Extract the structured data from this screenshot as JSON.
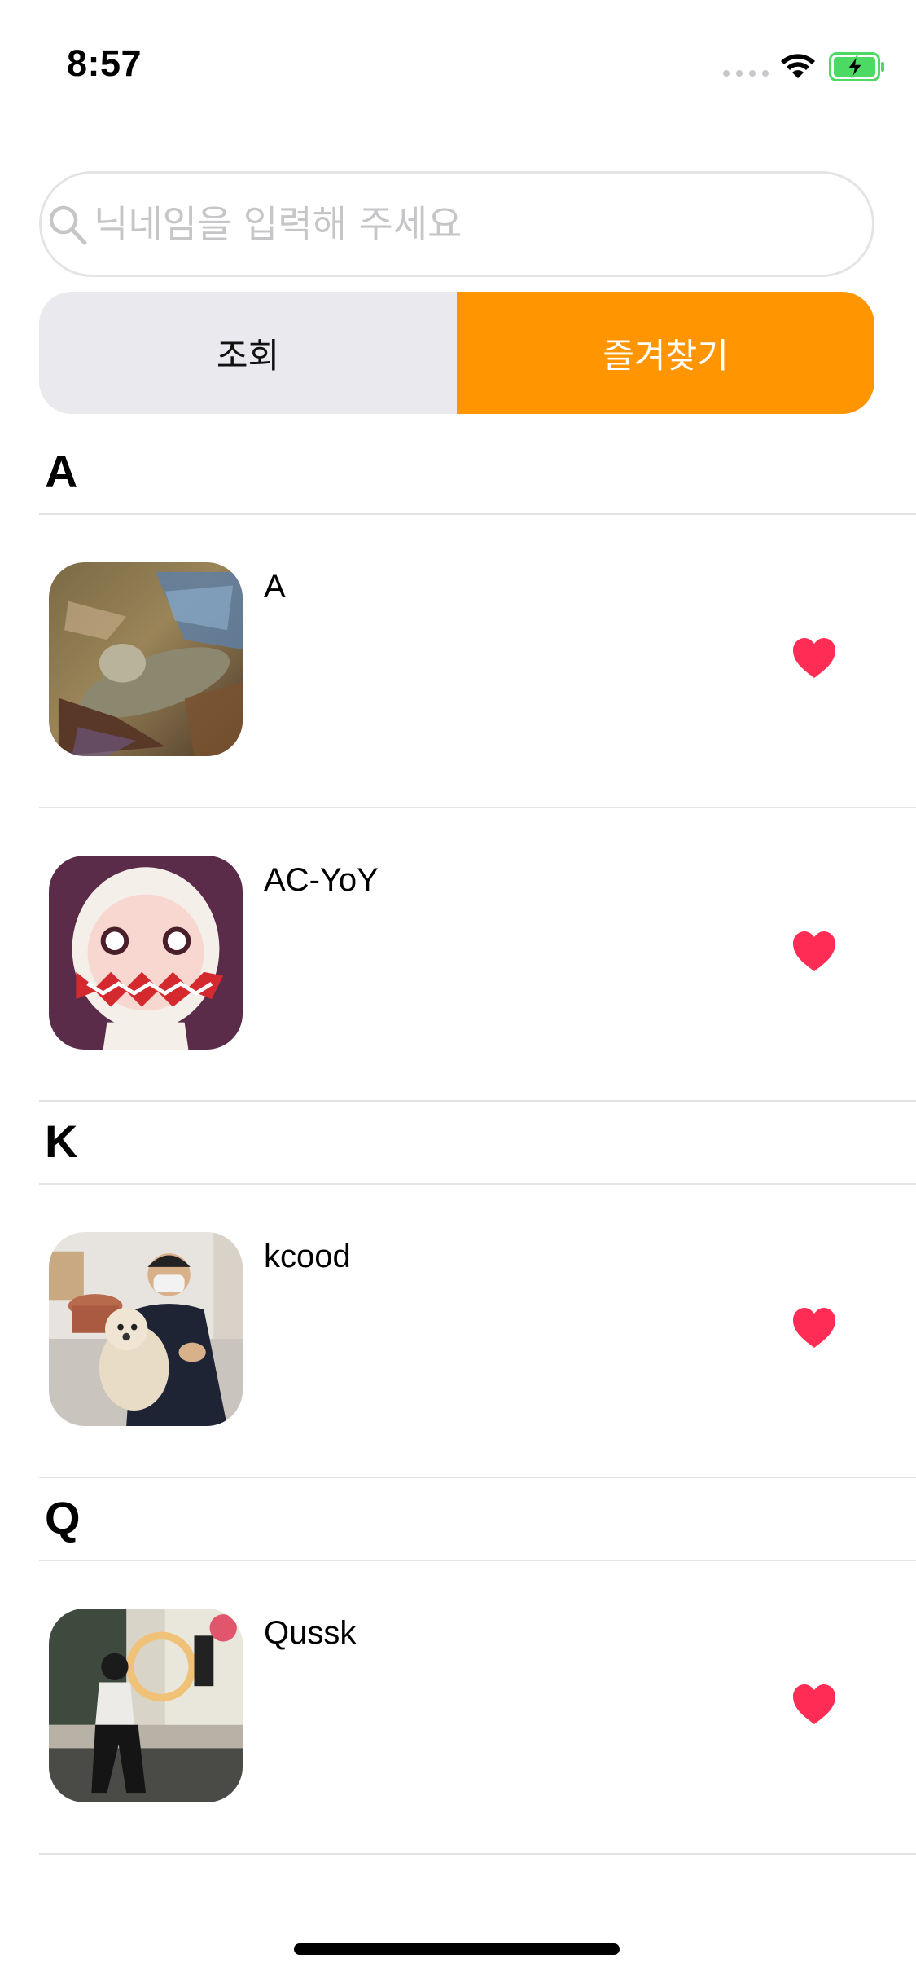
{
  "status_bar": {
    "time": "8:57"
  },
  "search": {
    "placeholder": "닉네임을 입력해 주세요",
    "value": ""
  },
  "segmented": {
    "left_label": "조회",
    "right_label": "즐겨찾기",
    "selected": "즐겨찾기"
  },
  "colors": {
    "accent": "#ff9500",
    "heart": "#ff2d55",
    "segment_bg": "#e9e9ee",
    "separator": "#e3e3e6"
  },
  "sections": [
    {
      "title": "A",
      "items": [
        {
          "name": "A",
          "favorited": true
        },
        {
          "name": "AC-YoY",
          "favorited": true
        }
      ]
    },
    {
      "title": "K",
      "items": [
        {
          "name": "kcood",
          "favorited": true
        }
      ]
    },
    {
      "title": "Q",
      "items": [
        {
          "name": "Qussk",
          "favorited": true
        }
      ]
    }
  ],
  "icons": {
    "search": "search-icon",
    "favorite": "heart-icon",
    "wifi": "wifi-icon",
    "battery": "battery-icon"
  }
}
